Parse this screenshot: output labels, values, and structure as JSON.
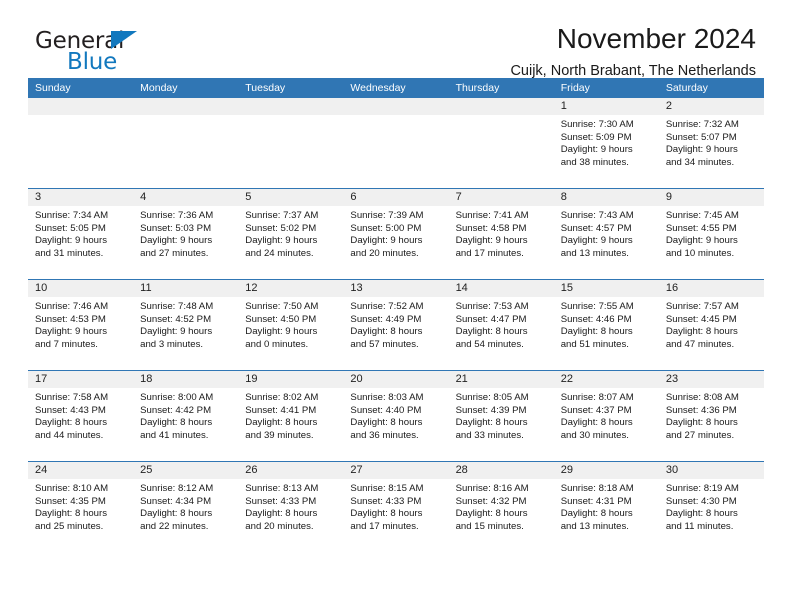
{
  "brand": {
    "name_part1": "General",
    "name_part2": "Blue",
    "accent_color": "#1278be"
  },
  "header": {
    "title": "November 2024",
    "subtitle": "Cuijk, North Brabant, The Netherlands",
    "header_bar_color": "#3076b4"
  },
  "weekdays": [
    "Sunday",
    "Monday",
    "Tuesday",
    "Wednesday",
    "Thursday",
    "Friday",
    "Saturday"
  ],
  "weeks": [
    [
      {
        "day": "",
        "sunrise": "",
        "sunset": "",
        "daylight1": "",
        "daylight2": ""
      },
      {
        "day": "",
        "sunrise": "",
        "sunset": "",
        "daylight1": "",
        "daylight2": ""
      },
      {
        "day": "",
        "sunrise": "",
        "sunset": "",
        "daylight1": "",
        "daylight2": ""
      },
      {
        "day": "",
        "sunrise": "",
        "sunset": "",
        "daylight1": "",
        "daylight2": ""
      },
      {
        "day": "",
        "sunrise": "",
        "sunset": "",
        "daylight1": "",
        "daylight2": ""
      },
      {
        "day": "1",
        "sunrise": "Sunrise: 7:30 AM",
        "sunset": "Sunset: 5:09 PM",
        "daylight1": "Daylight: 9 hours",
        "daylight2": "and 38 minutes."
      },
      {
        "day": "2",
        "sunrise": "Sunrise: 7:32 AM",
        "sunset": "Sunset: 5:07 PM",
        "daylight1": "Daylight: 9 hours",
        "daylight2": "and 34 minutes."
      }
    ],
    [
      {
        "day": "3",
        "sunrise": "Sunrise: 7:34 AM",
        "sunset": "Sunset: 5:05 PM",
        "daylight1": "Daylight: 9 hours",
        "daylight2": "and 31 minutes."
      },
      {
        "day": "4",
        "sunrise": "Sunrise: 7:36 AM",
        "sunset": "Sunset: 5:03 PM",
        "daylight1": "Daylight: 9 hours",
        "daylight2": "and 27 minutes."
      },
      {
        "day": "5",
        "sunrise": "Sunrise: 7:37 AM",
        "sunset": "Sunset: 5:02 PM",
        "daylight1": "Daylight: 9 hours",
        "daylight2": "and 24 minutes."
      },
      {
        "day": "6",
        "sunrise": "Sunrise: 7:39 AM",
        "sunset": "Sunset: 5:00 PM",
        "daylight1": "Daylight: 9 hours",
        "daylight2": "and 20 minutes."
      },
      {
        "day": "7",
        "sunrise": "Sunrise: 7:41 AM",
        "sunset": "Sunset: 4:58 PM",
        "daylight1": "Daylight: 9 hours",
        "daylight2": "and 17 minutes."
      },
      {
        "day": "8",
        "sunrise": "Sunrise: 7:43 AM",
        "sunset": "Sunset: 4:57 PM",
        "daylight1": "Daylight: 9 hours",
        "daylight2": "and 13 minutes."
      },
      {
        "day": "9",
        "sunrise": "Sunrise: 7:45 AM",
        "sunset": "Sunset: 4:55 PM",
        "daylight1": "Daylight: 9 hours",
        "daylight2": "and 10 minutes."
      }
    ],
    [
      {
        "day": "10",
        "sunrise": "Sunrise: 7:46 AM",
        "sunset": "Sunset: 4:53 PM",
        "daylight1": "Daylight: 9 hours",
        "daylight2": "and 7 minutes."
      },
      {
        "day": "11",
        "sunrise": "Sunrise: 7:48 AM",
        "sunset": "Sunset: 4:52 PM",
        "daylight1": "Daylight: 9 hours",
        "daylight2": "and 3 minutes."
      },
      {
        "day": "12",
        "sunrise": "Sunrise: 7:50 AM",
        "sunset": "Sunset: 4:50 PM",
        "daylight1": "Daylight: 9 hours",
        "daylight2": "and 0 minutes."
      },
      {
        "day": "13",
        "sunrise": "Sunrise: 7:52 AM",
        "sunset": "Sunset: 4:49 PM",
        "daylight1": "Daylight: 8 hours",
        "daylight2": "and 57 minutes."
      },
      {
        "day": "14",
        "sunrise": "Sunrise: 7:53 AM",
        "sunset": "Sunset: 4:47 PM",
        "daylight1": "Daylight: 8 hours",
        "daylight2": "and 54 minutes."
      },
      {
        "day": "15",
        "sunrise": "Sunrise: 7:55 AM",
        "sunset": "Sunset: 4:46 PM",
        "daylight1": "Daylight: 8 hours",
        "daylight2": "and 51 minutes."
      },
      {
        "day": "16",
        "sunrise": "Sunrise: 7:57 AM",
        "sunset": "Sunset: 4:45 PM",
        "daylight1": "Daylight: 8 hours",
        "daylight2": "and 47 minutes."
      }
    ],
    [
      {
        "day": "17",
        "sunrise": "Sunrise: 7:58 AM",
        "sunset": "Sunset: 4:43 PM",
        "daylight1": "Daylight: 8 hours",
        "daylight2": "and 44 minutes."
      },
      {
        "day": "18",
        "sunrise": "Sunrise: 8:00 AM",
        "sunset": "Sunset: 4:42 PM",
        "daylight1": "Daylight: 8 hours",
        "daylight2": "and 41 minutes."
      },
      {
        "day": "19",
        "sunrise": "Sunrise: 8:02 AM",
        "sunset": "Sunset: 4:41 PM",
        "daylight1": "Daylight: 8 hours",
        "daylight2": "and 39 minutes."
      },
      {
        "day": "20",
        "sunrise": "Sunrise: 8:03 AM",
        "sunset": "Sunset: 4:40 PM",
        "daylight1": "Daylight: 8 hours",
        "daylight2": "and 36 minutes."
      },
      {
        "day": "21",
        "sunrise": "Sunrise: 8:05 AM",
        "sunset": "Sunset: 4:39 PM",
        "daylight1": "Daylight: 8 hours",
        "daylight2": "and 33 minutes."
      },
      {
        "day": "22",
        "sunrise": "Sunrise: 8:07 AM",
        "sunset": "Sunset: 4:37 PM",
        "daylight1": "Daylight: 8 hours",
        "daylight2": "and 30 minutes."
      },
      {
        "day": "23",
        "sunrise": "Sunrise: 8:08 AM",
        "sunset": "Sunset: 4:36 PM",
        "daylight1": "Daylight: 8 hours",
        "daylight2": "and 27 minutes."
      }
    ],
    [
      {
        "day": "24",
        "sunrise": "Sunrise: 8:10 AM",
        "sunset": "Sunset: 4:35 PM",
        "daylight1": "Daylight: 8 hours",
        "daylight2": "and 25 minutes."
      },
      {
        "day": "25",
        "sunrise": "Sunrise: 8:12 AM",
        "sunset": "Sunset: 4:34 PM",
        "daylight1": "Daylight: 8 hours",
        "daylight2": "and 22 minutes."
      },
      {
        "day": "26",
        "sunrise": "Sunrise: 8:13 AM",
        "sunset": "Sunset: 4:33 PM",
        "daylight1": "Daylight: 8 hours",
        "daylight2": "and 20 minutes."
      },
      {
        "day": "27",
        "sunrise": "Sunrise: 8:15 AM",
        "sunset": "Sunset: 4:33 PM",
        "daylight1": "Daylight: 8 hours",
        "daylight2": "and 17 minutes."
      },
      {
        "day": "28",
        "sunrise": "Sunrise: 8:16 AM",
        "sunset": "Sunset: 4:32 PM",
        "daylight1": "Daylight: 8 hours",
        "daylight2": "and 15 minutes."
      },
      {
        "day": "29",
        "sunrise": "Sunrise: 8:18 AM",
        "sunset": "Sunset: 4:31 PM",
        "daylight1": "Daylight: 8 hours",
        "daylight2": "and 13 minutes."
      },
      {
        "day": "30",
        "sunrise": "Sunrise: 8:19 AM",
        "sunset": "Sunset: 4:30 PM",
        "daylight1": "Daylight: 8 hours",
        "daylight2": "and 11 minutes."
      }
    ]
  ]
}
